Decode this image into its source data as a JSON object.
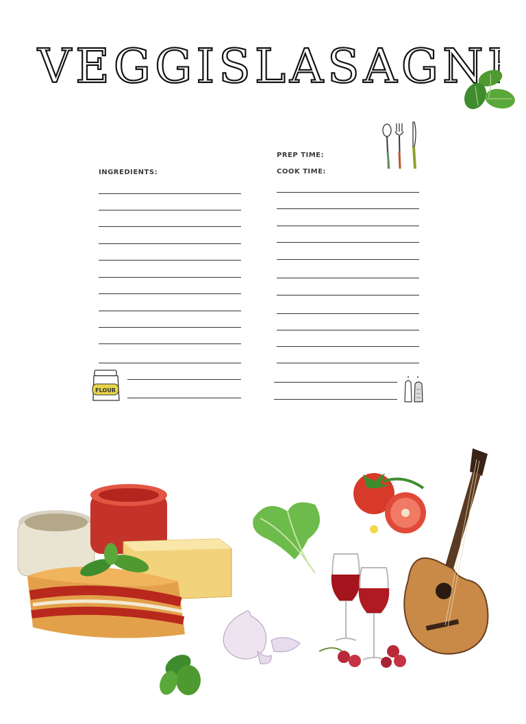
{
  "title": "VEGGISLASAGNE",
  "labels": {
    "ingredients": "INGREDIENTS:",
    "prep_time": "PREP TIME:",
    "cook_time": "COOK TIME:"
  },
  "icons": {
    "flour_jar_text": "FLOUR"
  },
  "colors": {
    "text": "#3a3a3a",
    "lines": "#333333",
    "basil": "#3e8c2e",
    "tomato": "#d83a2a",
    "wine": "#a3141c",
    "guitar": "#b0743a"
  }
}
